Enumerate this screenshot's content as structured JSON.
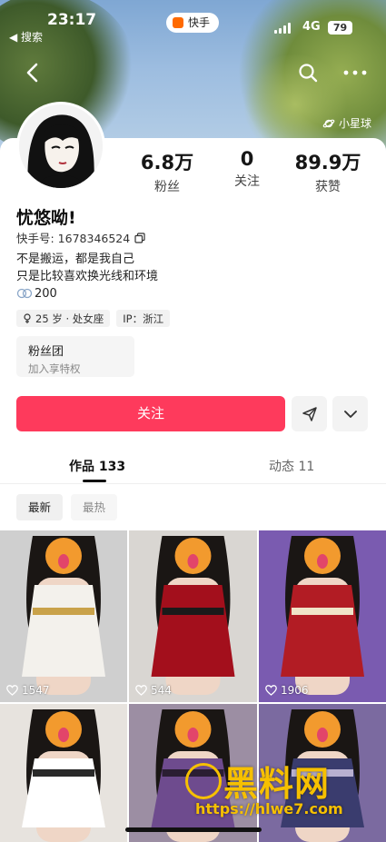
{
  "status_bar": {
    "time": "23:17",
    "back_app": "◀ 搜索",
    "app_name": "快手",
    "network": "4G",
    "battery": "79"
  },
  "header": {
    "star_link": "小星球"
  },
  "profile": {
    "name": "忧悠呦!",
    "uid_label": "快手号: 1678346524",
    "bio_line1": "不是搬运，都是我自己",
    "bio_line2": "只是比较喜欢换光线和环境",
    "bio_extra": "200",
    "tags": [
      "25 岁 · 处女座",
      "IP：浙江"
    ]
  },
  "stats": [
    {
      "value": "6.8万",
      "label": "粉丝"
    },
    {
      "value": "0",
      "label": "关注"
    },
    {
      "value": "89.9万",
      "label": "获赞"
    }
  ],
  "fan_club": {
    "title": "粉丝团",
    "subtitle": "加入享特权"
  },
  "actions": {
    "follow_label": "关注"
  },
  "tabs": [
    {
      "label": "作品 133",
      "active": true
    },
    {
      "label": "动态 11",
      "active": false
    }
  ],
  "filters": [
    {
      "label": "最新",
      "active": true
    },
    {
      "label": "最热",
      "active": false
    }
  ],
  "posts": [
    {
      "likes": "1547",
      "bg": "#cfcfcf",
      "outfit": "#f3f1ec",
      "accent": "#c9a24a"
    },
    {
      "likes": "544",
      "bg": "#d9d6d2",
      "outfit": "#a30f1c",
      "accent": "#1a1a1a"
    },
    {
      "likes": "1906",
      "bg": "#7a5bb0",
      "outfit": "#b21c24",
      "accent": "#f0e4c8"
    },
    {
      "likes": "",
      "bg": "#e7e3de",
      "outfit": "#ffffff",
      "accent": "#2a2a2a"
    },
    {
      "likes": "",
      "bg": "#9c8ea3",
      "outfit": "#6e4b8e",
      "accent": "#2b1e33"
    },
    {
      "likes": "",
      "bg": "#7b6aa0",
      "outfit": "#3a3c6e",
      "accent": "#b8b0d0"
    }
  ],
  "watermark": {
    "title": "黑料网",
    "url": "https://hlwe7.com"
  },
  "colors": {
    "follow": "#fe3a5c",
    "watermark": "#f6c000"
  }
}
